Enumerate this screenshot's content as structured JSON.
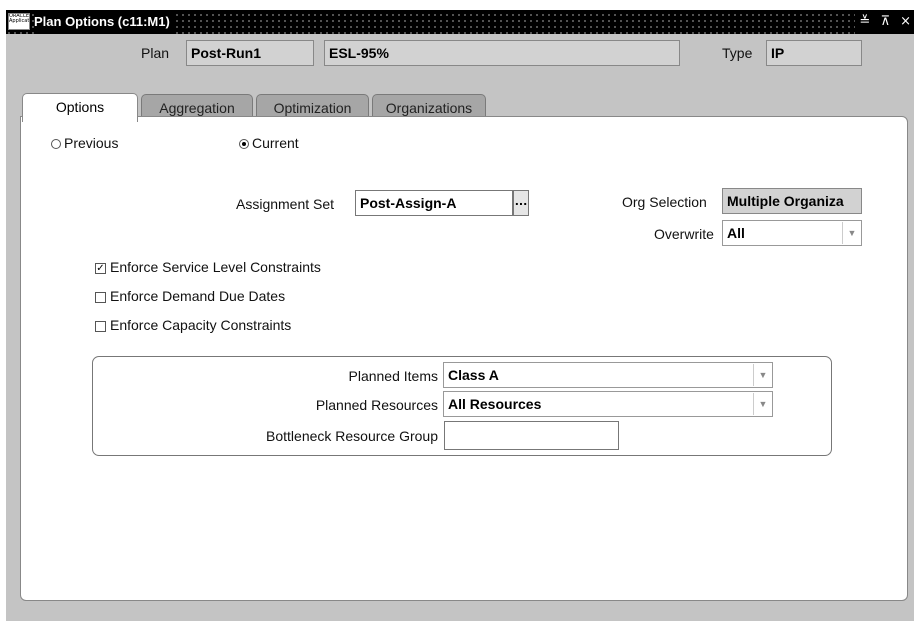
{
  "window": {
    "title": "Plan Options (c11:M1)",
    "app_icon_text": "ORACLE Applications",
    "controls": "≚ ⊼ ×"
  },
  "header": {
    "plan_label": "Plan",
    "plan_name": "Post-Run1",
    "plan_description": "ESL-95%",
    "type_label": "Type",
    "type_value": "IP"
  },
  "tabs": [
    {
      "label": "Options",
      "active": true
    },
    {
      "label": "Aggregation",
      "active": false
    },
    {
      "label": "Optimization",
      "active": false
    },
    {
      "label": "Organizations",
      "active": false
    }
  ],
  "options": {
    "radio_previous": "Previous",
    "radio_current": "Current",
    "selected_radio": "Current",
    "assignment_set_label": "Assignment Set",
    "assignment_set_value": "Post-Assign-A",
    "lov_button": "...",
    "org_selection_label": "Org Selection",
    "org_selection_value": "Multiple Organiza",
    "overwrite_label": "Overwrite",
    "overwrite_value": "All",
    "checkboxes": [
      {
        "label": "Enforce Service Level Constraints",
        "checked": true
      },
      {
        "label": "Enforce Demand Due Dates",
        "checked": false
      },
      {
        "label": "Enforce Capacity Constraints",
        "checked": false
      }
    ],
    "planned_items_label": "Planned Items",
    "planned_items_value": "Class A",
    "planned_resources_label": "Planned Resources",
    "planned_resources_value": "All Resources",
    "bottleneck_label": "Bottleneck Resource Group",
    "bottleneck_value": ""
  }
}
